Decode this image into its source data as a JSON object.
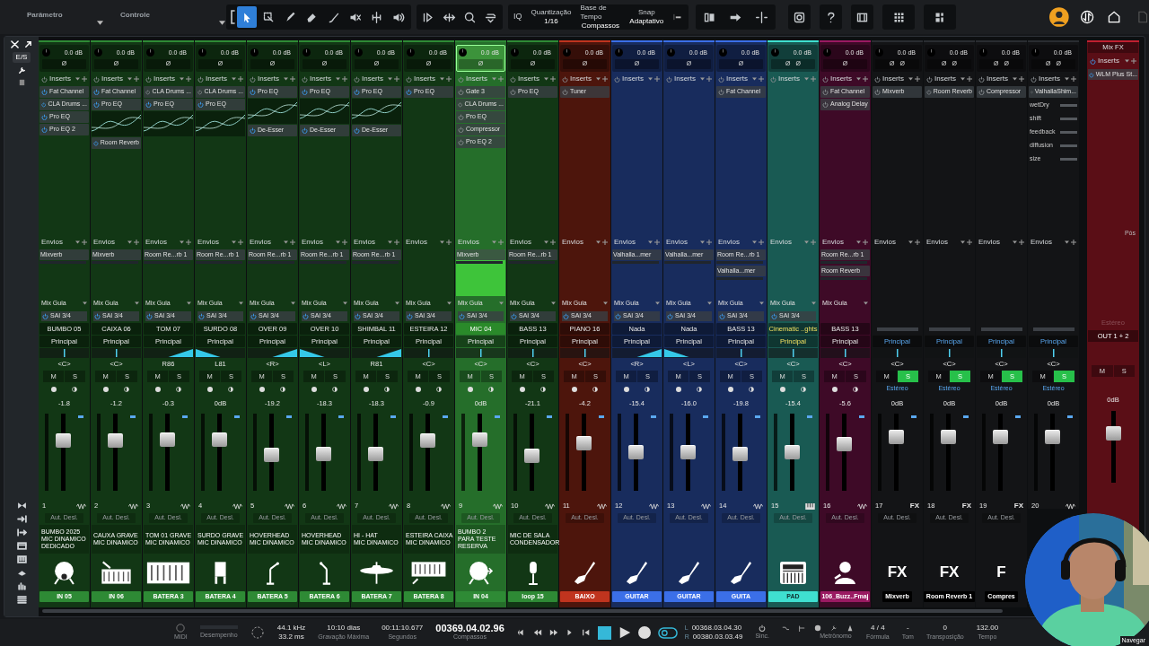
{
  "toolbar": {
    "parameter": "Parâmetro",
    "control": "Controle",
    "tools": [
      {
        "selected": true
      },
      {
        "selected": false
      },
      {
        "selected": false
      },
      {
        "selected": false
      },
      {
        "selected": false
      },
      {
        "selected": false
      },
      {
        "selected": false
      },
      {
        "selected": false
      }
    ],
    "iq": "IQ",
    "quantize_label": "Quantização",
    "quantize": "1/16",
    "timebase_label": "Base de Tempo",
    "timebase": "Compassos",
    "snap_label": "Snap",
    "snap": "Adaptativo"
  },
  "side": {
    "io": "E/S"
  },
  "channels": [
    {
      "kind": "track",
      "color": "#2e8a35",
      "selected": false,
      "trim": "0.0 dB",
      "phase": [
        "Ø"
      ],
      "inserts_label": "Inserts",
      "inserts": [
        {
          "name": "Fat Channel",
          "on": true
        },
        {
          "name": "CLA Drums ...",
          "on": true
        },
        {
          "name": "Pro EQ",
          "on": true
        },
        {
          "name": "Pro EQ 2",
          "on": true
        }
      ],
      "sends_label": "Envios",
      "sends": [
        "Mixverb"
      ],
      "mix": "Mix Guia",
      "out_send": "SAI 3/4",
      "name": "BUMBO 05",
      "output": "Principal",
      "pan": {
        "text": "<C>",
        "kind": "center"
      },
      "mute_label": "M",
      "solo_label": "S",
      "mute": false,
      "solo": false,
      "volume": "-1.8",
      "level": 0.68,
      "number": "1",
      "auto": "Aut. Desl.",
      "comment": [
        "BUMBO 2025",
        "MIC DINAMICO",
        "DEDICADO"
      ],
      "label": "IN 05"
    },
    {
      "kind": "track",
      "color": "#2e8a35",
      "selected": false,
      "trim": "0.0 dB",
      "phase": [
        "Ø"
      ],
      "inserts_label": "Inserts",
      "inserts": [
        {
          "name": "Fat Channel",
          "on": true
        },
        {
          "name": "Pro EQ",
          "on": true,
          "graph": true
        },
        {
          "name": "Room Reverb",
          "on": true
        }
      ],
      "sends_label": "Envios",
      "sends": [
        "Mixverb"
      ],
      "mix": "Mix Guia",
      "out_send": "SAI 3/4",
      "name": "CAIXA 06",
      "output": "Principal",
      "pan": {
        "text": "<C>",
        "kind": "center"
      },
      "mute_label": "M",
      "solo_label": "S",
      "mute": false,
      "solo": false,
      "volume": "-1.2",
      "level": 0.68,
      "number": "2",
      "auto": "Aut. Desl.",
      "comment": [
        "CAUXA GRAVE",
        "MIC DINAMICO"
      ],
      "label": "IN 06"
    },
    {
      "kind": "track",
      "color": "#2e8a35",
      "selected": false,
      "trim": "0.0 dB",
      "phase": [
        "Ø"
      ],
      "inserts_label": "Inserts",
      "inserts": [
        {
          "name": "CLA Drums ...",
          "on": false
        },
        {
          "name": "Pro EQ",
          "on": true,
          "graph": true
        }
      ],
      "sends_label": "Envios",
      "sends": [
        "Room Re...rb 1"
      ],
      "mix": "Mix Guia",
      "out_send": "SAI 3/4",
      "name": "TOM 07",
      "output": "Principal",
      "pan": {
        "text": "R86",
        "kind": "right"
      },
      "mute_label": "M",
      "solo_label": "S",
      "mute": false,
      "solo": false,
      "volume": "-0.3",
      "level": 0.7,
      "number": "3",
      "auto": "Aut. Desl.",
      "comment": [
        "TOM 01 GRAVE",
        "MIC DINAMICO"
      ],
      "label": "BATERA 3"
    },
    {
      "kind": "track",
      "color": "#2e8a35",
      "selected": false,
      "trim": "0.0 dB",
      "phase": [
        "Ø"
      ],
      "inserts_label": "Inserts",
      "inserts": [
        {
          "name": "CLA Drums ...",
          "on": false
        },
        {
          "name": "Pro EQ",
          "on": true,
          "graph": true
        }
      ],
      "sends_label": "Envios",
      "sends": [
        "Room Re...rb 1"
      ],
      "mix": "Mix Guia",
      "out_send": "SAI 3/4",
      "name": "SURDO 08",
      "output": "Principal",
      "pan": {
        "text": "L81",
        "kind": "left"
      },
      "mute_label": "M",
      "solo_label": "S",
      "mute": false,
      "solo": false,
      "volume": "0dB",
      "level": 0.7,
      "number": "4",
      "auto": "Aut. Desl.",
      "comment": [
        "SURDO GRAVE",
        "MIC DINAMICO"
      ],
      "label": "BATERA 4"
    },
    {
      "kind": "track",
      "color": "#2e8a35",
      "selected": false,
      "trim": "0.0 dB",
      "phase": [
        "Ø"
      ],
      "inserts_label": "Inserts",
      "inserts": [
        {
          "name": "Pro EQ",
          "on": true,
          "graph": true
        },
        {
          "name": "De-Esser",
          "on": true
        }
      ],
      "sends_label": "Envios",
      "sends": [
        "Room Re...rb 1"
      ],
      "mix": "Mix Guia",
      "out_send": "SAI 3/4",
      "name": "OVER 09",
      "output": "Principal",
      "pan": {
        "text": "<R>",
        "kind": "right"
      },
      "mute_label": "M",
      "solo_label": "S",
      "mute": false,
      "solo": false,
      "volume": "-19.2",
      "level": 0.46,
      "number": "5",
      "auto": "Aut. Desl.",
      "comment": [
        "HOVERHEAD",
        "MIC DINAMICO"
      ],
      "label": "BATERA 5"
    },
    {
      "kind": "track",
      "color": "#2e8a35",
      "selected": false,
      "trim": "0.0 dB",
      "phase": [
        "Ø"
      ],
      "inserts_label": "Inserts",
      "inserts": [
        {
          "name": "Pro EQ",
          "on": true,
          "graph": true
        },
        {
          "name": "De-Esser",
          "on": true
        }
      ],
      "sends_label": "Envios",
      "sends": [
        "Room Re...rb 1"
      ],
      "mix": "Mix Guia",
      "out_send": "SAI 3/4",
      "name": "OVER 10",
      "output": "Principal",
      "pan": {
        "text": "<L>",
        "kind": "left"
      },
      "mute_label": "M",
      "solo_label": "S",
      "mute": false,
      "solo": false,
      "volume": "-18.3",
      "level": 0.47,
      "number": "6",
      "auto": "Aut. Desl.",
      "comment": [
        "HOVERHEAD",
        "MIC DINAMICO"
      ],
      "label": "BATERA 6"
    },
    {
      "kind": "track",
      "color": "#2e8a35",
      "selected": false,
      "trim": "0.0 dB",
      "phase": [
        "Ø"
      ],
      "inserts_label": "Inserts",
      "inserts": [
        {
          "name": "Pro EQ",
          "on": true,
          "graph": true
        },
        {
          "name": "De-Esser",
          "on": true
        }
      ],
      "sends_label": "Envios",
      "sends": [
        "Room Re...rb 1"
      ],
      "mix": "Mix Guia",
      "out_send": "SAI 3/4",
      "name": "SHIMBAL 11",
      "output": "Principal",
      "pan": {
        "text": "R81",
        "kind": "right"
      },
      "mute_label": "M",
      "solo_label": "S",
      "mute": false,
      "solo": false,
      "volume": "-18.3",
      "level": 0.47,
      "number": "7",
      "auto": "Aut. Desl.",
      "comment": [
        "HI - HAT",
        "MIC DINAMICO"
      ],
      "label": "BATERA 7"
    },
    {
      "kind": "track",
      "color": "#2e8a35",
      "selected": false,
      "trim": "0.0 dB",
      "phase": [
        "Ø"
      ],
      "inserts_label": "Inserts",
      "inserts": [
        {
          "name": "Pro EQ",
          "on": true
        }
      ],
      "sends_label": "Envios",
      "mix": "Mix Guia",
      "out_send": "SAI 3/4",
      "name": "ESTEIRA 12",
      "output": "Principal",
      "pan": {
        "text": "<C>",
        "kind": "center"
      },
      "mute_label": "M",
      "solo_label": "S",
      "mute": false,
      "solo": false,
      "volume": "-0.9",
      "level": 0.69,
      "number": "8",
      "auto": "Aut. Desl.",
      "comment": [
        "ESTEIRA CAIXA",
        "MIC DINAMICO"
      ],
      "label": "BATERA 8"
    },
    {
      "kind": "track",
      "color": "#2e8a35",
      "selected": true,
      "trim": "0.0 dB",
      "phase": [
        "Ø"
      ],
      "inserts_label": "Inserts",
      "inserts": [
        {
          "name": "Gate 3",
          "on": false
        },
        {
          "name": "CLA Drums ...",
          "on": false
        },
        {
          "name": "Pro EQ",
          "on": false
        },
        {
          "name": "Compressor",
          "on": false
        },
        {
          "name": "Pro EQ 2",
          "on": false
        }
      ],
      "sends_label": "Envios",
      "sends": [
        "Mixverb"
      ],
      "mix": "Mix Guia",
      "out_send": "SAI 3/4",
      "name": "MIC 04",
      "output": "Principal",
      "pan": {
        "text": "<C>",
        "kind": "center"
      },
      "mute_label": "M",
      "solo_label": "S",
      "mute": false,
      "solo": false,
      "volume": "0dB",
      "level": 0.7,
      "number": "9",
      "auto": "Aut. Desl.",
      "comment": [
        "BUMBO 2",
        "PARA TESTE",
        "RESERVA"
      ],
      "label": "IN 04"
    },
    {
      "kind": "track",
      "color": "#2e8a35",
      "selected": false,
      "trim": "0.0 dB",
      "phase": [
        "Ø"
      ],
      "inserts_label": "Inserts",
      "inserts": [
        {
          "name": "Pro EQ",
          "on": false
        }
      ],
      "sends_label": "Envios",
      "sends": [
        "Room Re...rb 1"
      ],
      "mix": "Mix Guia",
      "out_send": "SAI 3/4",
      "name": "BASS 13",
      "output": "Principal",
      "pan": {
        "text": "<C>",
        "kind": "center"
      },
      "mute_label": "M",
      "solo_label": "S",
      "mute": false,
      "solo": false,
      "volume": "-21.1",
      "level": 0.45,
      "number": "10",
      "auto": "Aut. Desl.",
      "comment": [
        "MIC DE SALA",
        "CONDENSADOR"
      ],
      "label": "loop 15"
    },
    {
      "kind": "track",
      "color": "#c0341e",
      "selected": false,
      "trim": "0.0 dB",
      "phase": [
        "Ø"
      ],
      "inserts_label": "Inserts",
      "inserts": [
        {
          "name": "Tuner",
          "on": false
        }
      ],
      "sends_label": "Envios",
      "mix": "Mix Guia",
      "out_send": "SAI 3/4",
      "name": "PIANO 16",
      "output": "Principal",
      "pan": {
        "text": "<C>",
        "kind": "center"
      },
      "mute_label": "M",
      "solo_label": "S",
      "mute": false,
      "solo": false,
      "volume": "-4.2",
      "level": 0.65,
      "number": "11",
      "auto": "Aut. Desl.",
      "label": "BAIXO"
    },
    {
      "kind": "track",
      "color": "#3b6fe8",
      "selected": false,
      "trim": "0.0 dB",
      "phase": [
        "Ø"
      ],
      "inserts_label": "Inserts",
      "sends_label": "Envios",
      "sends": [
        "Valhalla...mer"
      ],
      "mix": "Mix Guia",
      "out_send": "SAI 3/4",
      "name": "Nada",
      "output": "Principal",
      "pan": {
        "text": "<R>",
        "kind": "right"
      },
      "mute_label": "M",
      "solo_label": "S",
      "mute": false,
      "solo": false,
      "volume": "-15.4",
      "level": 0.5,
      "number": "12",
      "auto": "Aut. Desl.",
      "label": "GUITAR"
    },
    {
      "kind": "track",
      "color": "#3b6fe8",
      "selected": false,
      "trim": "0.0 dB",
      "phase": [
        "Ø"
      ],
      "inserts_label": "Inserts",
      "sends_label": "Envios",
      "sends": [
        "Valhalla...mer"
      ],
      "mix": "Mix Guia",
      "out_send": "SAI 3/4",
      "name": "Nada",
      "output": "Principal",
      "pan": {
        "text": "<L>",
        "kind": "left"
      },
      "mute_label": "M",
      "solo_label": "S",
      "mute": false,
      "solo": false,
      "volume": "-16.0",
      "level": 0.5,
      "number": "13",
      "auto": "Aut. Desl.",
      "label": "GUITAR"
    },
    {
      "kind": "track",
      "color": "#3b6fe8",
      "selected": false,
      "trim": "0.0 dB",
      "phase": [
        "Ø"
      ],
      "inserts_label": "Inserts",
      "inserts": [
        {
          "name": "Fat Channel",
          "on": false
        }
      ],
      "sends_label": "Envios",
      "sends": [
        "Room Re...rb 1",
        "Valhalla...mer"
      ],
      "mix": "Mix Guia",
      "out_send": "SAI 3/4",
      "name": "BASS 13",
      "output": "Principal",
      "pan": {
        "text": "<C>",
        "kind": "center"
      },
      "mute_label": "M",
      "solo_label": "S",
      "mute": false,
      "solo": false,
      "volume": "-19.8",
      "level": 0.47,
      "number": "14",
      "auto": "Aut. Desl.",
      "label": "GUITA"
    },
    {
      "kind": "track",
      "color": "#3fe0d0",
      "selected": false,
      "trim": "0.0 dB",
      "phase": [
        "Ø",
        "Ø"
      ],
      "inserts_label": "Inserts",
      "sends_label": "Envios",
      "mix": "Mix Guia",
      "out_send": "SAI 3/4",
      "name": "Cinematic ..ghts",
      "output": "Principal",
      "pan": {
        "text": "<C>",
        "kind": "center"
      },
      "mute_label": "M",
      "solo_label": "S",
      "mute": false,
      "solo": false,
      "volume": "-15.4",
      "level": 0.5,
      "number": "15",
      "auto": "Aut. Desl.",
      "label": "PAD"
    },
    {
      "kind": "track",
      "color": "#9a1a62",
      "selected": false,
      "trim": "0.0 dB",
      "phase": [
        "Ø"
      ],
      "inserts_label": "Inserts",
      "inserts": [
        {
          "name": "Fat Channel",
          "on": false
        },
        {
          "name": "Analog Delay",
          "on": false
        }
      ],
      "sends_label": "Envios",
      "sends": [
        "Room Re...rb 1",
        "Room Reverb"
      ],
      "mix": "Mix Guia",
      "name": "BASS 13",
      "output": "Principal",
      "pan": {
        "text": "<C>",
        "kind": "center"
      },
      "mute_label": "M",
      "solo_label": "S",
      "mute": false,
      "solo": false,
      "volume": "-5.6",
      "level": 0.63,
      "number": "16",
      "auto": "Aut. Desl.",
      "label": "106_Buzz..Fmaj"
    },
    {
      "kind": "fx",
      "color": "#2a2d31",
      "selected": false,
      "trim": "0.0 dB",
      "phase": [
        "Ø",
        "Ø"
      ],
      "inserts_label": "Inserts",
      "inserts": [
        {
          "name": "Mixverb",
          "on": false
        }
      ],
      "sends_label": "Envios",
      "output": "Principal",
      "pan": {
        "text": "<C>",
        "kind": "center"
      },
      "mute_label": "M",
      "solo_label": "S",
      "mute": false,
      "solo": true,
      "mode": "Estéreo",
      "volume": "0dB",
      "level": 0.74,
      "number": "17",
      "badge": "FX",
      "auto": "Aut. Desl.",
      "big": "FX",
      "label": "Mixverb"
    },
    {
      "kind": "fx",
      "color": "#2a2d31",
      "selected": false,
      "trim": "0.0 dB",
      "phase": [
        "Ø",
        "Ø"
      ],
      "inserts_label": "Inserts",
      "inserts": [
        {
          "name": "Room Reverb",
          "on": false
        }
      ],
      "sends_label": "Envios",
      "output": "Principal",
      "pan": {
        "text": "<C>",
        "kind": "center"
      },
      "mute_label": "M",
      "solo_label": "S",
      "mute": false,
      "solo": true,
      "mode": "Estéreo",
      "volume": "0dB",
      "level": 0.74,
      "number": "18",
      "badge": "FX",
      "auto": "Aut. Desl.",
      "big": "FX",
      "label": "Room Reverb 1"
    },
    {
      "kind": "fx",
      "color": "#2a2d31",
      "selected": false,
      "trim": "0.0 dB",
      "phase": [
        "Ø",
        "Ø"
      ],
      "inserts_label": "Inserts",
      "inserts": [
        {
          "name": "Compressor",
          "on": false
        }
      ],
      "sends_label": "Envios",
      "output": "Principal",
      "pan": {
        "text": "<C>",
        "kind": "center"
      },
      "mute_label": "M",
      "solo_label": "S",
      "mute": false,
      "solo": true,
      "mode": "Estéreo",
      "volume": "0dB",
      "level": 0.74,
      "number": "19",
      "badge": "FX",
      "auto": "Aut. Desl.",
      "big": "F",
      "label": "Compres"
    },
    {
      "kind": "fx",
      "color": "#2a2d31",
      "selected": false,
      "trim": "0.0 dB",
      "phase": [
        "Ø",
        "Ø"
      ],
      "inserts_label": "Inserts",
      "inserts": [
        {
          "name": "ValhallaShim...",
          "on": false,
          "params": [
            "wetDry",
            "shift",
            "feedback",
            "diffusion",
            "size"
          ]
        }
      ],
      "sends_label": "Envios",
      "output": "Principal",
      "pan": {
        "text": "<C>",
        "kind": "center"
      },
      "mute_label": "M",
      "solo_label": "S",
      "mute": false,
      "solo": true,
      "mode": "Estéreo",
      "volume": "0dB",
      "level": 0.74,
      "number": "20"
    }
  ],
  "mix_fx": {
    "title": "Mix FX",
    "inserts_label": "Inserts",
    "inserts": [
      {
        "name": "WLM Plus St...",
        "on": true
      }
    ],
    "post": "Pós",
    "mode": "Estéreo",
    "output": "OUT 1 + 2",
    "mute_label": "M",
    "solo_label": "S",
    "volume": "0dB",
    "level": 0.74
  },
  "transport": {
    "midi": "MIDI",
    "performance": "Desempenho",
    "sample_rate": "44.1 kHz",
    "latency": "33.2 ms",
    "record_time": "10:10 dias",
    "record_label": "Gravação Máxima",
    "seconds": "00:11:10.677",
    "seconds_unit": "Segundos",
    "bars": "00369.04.02.96",
    "bars_unit": "Compassos",
    "loop_l": "L",
    "loop_start": "00368.03.04.30",
    "loop_r": "R",
    "loop_end": "00380.03.03.49",
    "sync": "Sinc.",
    "metronome": "Metrônomo",
    "signature": "4 / 4",
    "signature_label": "Fórmula",
    "key": "-",
    "key_label": "Tom",
    "transpose": "0",
    "transpose_label": "Transposição",
    "tempo": "132.00",
    "tempo_label": "Tempo",
    "navigate": "Navegar"
  }
}
